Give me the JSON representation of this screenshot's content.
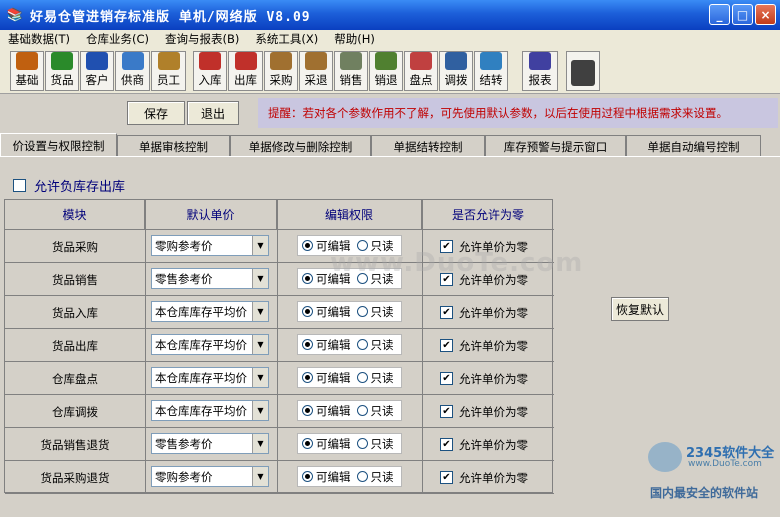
{
  "window": {
    "title": "好易仓管进销存标准版 单机/网络版 V8.09",
    "minimize": "_",
    "maximize": "□",
    "close": "×"
  },
  "menu": [
    "基础数据(T)",
    "仓库业务(C)",
    "查询与报表(B)",
    "系统工具(X)",
    "帮助(H)"
  ],
  "toolbar": [
    {
      "label": "基础",
      "icon": "basics-icon",
      "color": "#c06010"
    },
    {
      "label": "货品",
      "icon": "goods-icon",
      "color": "#2a8a2a"
    },
    {
      "label": "客户",
      "icon": "customer-icon",
      "color": "#2050b0"
    },
    {
      "label": "供商",
      "icon": "supplier-icon",
      "color": "#3a7ac8"
    },
    {
      "label": "员工",
      "icon": "employee-icon",
      "color": "#b0802a"
    },
    {
      "label": "入库",
      "icon": "stock-in-icon",
      "color": "#c0302a"
    },
    {
      "label": "出库",
      "icon": "stock-out-icon",
      "color": "#c0302a"
    },
    {
      "label": "采购",
      "icon": "purchase-icon",
      "color": "#a07030"
    },
    {
      "label": "采退",
      "icon": "purchase-return-icon",
      "color": "#a07030"
    },
    {
      "label": "销售",
      "icon": "sales-icon",
      "color": "#708060"
    },
    {
      "label": "销退",
      "icon": "sales-return-icon",
      "color": "#508030"
    },
    {
      "label": "盘点",
      "icon": "inventory-check-icon",
      "color": "#c04040"
    },
    {
      "label": "调拨",
      "icon": "transfer-icon",
      "color": "#3060a0"
    },
    {
      "label": "结转",
      "icon": "carry-over-icon",
      "color": "#3080c0"
    },
    {
      "label": "报表",
      "icon": "report-icon",
      "color": "#4040a0"
    },
    {
      "label": "",
      "icon": "exit-door-icon",
      "color": "#404040"
    }
  ],
  "actions": {
    "save": "保存",
    "exit": "退出"
  },
  "hint": "提醒：若对各个参数作用不了解，可先使用默认参数，以后在使用过程中根据需求来设置。",
  "tabs": [
    "价设置与权限控制",
    "单据审核控制",
    "单据修改与删除控制",
    "单据结转控制",
    "库存预警与提示窗口",
    "单据自动编号控制"
  ],
  "negative_stock": {
    "label": "允许负库存出库",
    "checked": false
  },
  "grid": {
    "headers": [
      "模块",
      "默认单价",
      "编辑权限",
      "是否允许为零"
    ],
    "radio_edit": "可编辑",
    "radio_readonly": "只读",
    "allow_zero_label": "允许单价为零",
    "rows": [
      {
        "module": "货品采购",
        "price": "零购参考价",
        "edit": true,
        "allow_zero": true
      },
      {
        "module": "货品销售",
        "price": "零售参考价",
        "edit": true,
        "allow_zero": true
      },
      {
        "module": "货品入库",
        "price": "本仓库库存平均价",
        "edit": true,
        "allow_zero": true
      },
      {
        "module": "货品出库",
        "price": "本仓库库存平均价",
        "edit": true,
        "allow_zero": true
      },
      {
        "module": "仓库盘点",
        "price": "本仓库库存平均价",
        "edit": true,
        "allow_zero": true
      },
      {
        "module": "仓库调拨",
        "price": "本仓库库存平均价",
        "edit": true,
        "allow_zero": true
      },
      {
        "module": "货品销售退货",
        "price": "零售参考价",
        "edit": true,
        "allow_zero": true
      },
      {
        "module": "货品采购退货",
        "price": "零购参考价",
        "edit": true,
        "allow_zero": true
      }
    ]
  },
  "restore_default": "恢复默认",
  "watermarks": {
    "site": "www.DuoTe.com",
    "brand": "2345软件大全",
    "brand_url": "www.DuoTe.com",
    "slogan": "国内最安全的软件站"
  }
}
